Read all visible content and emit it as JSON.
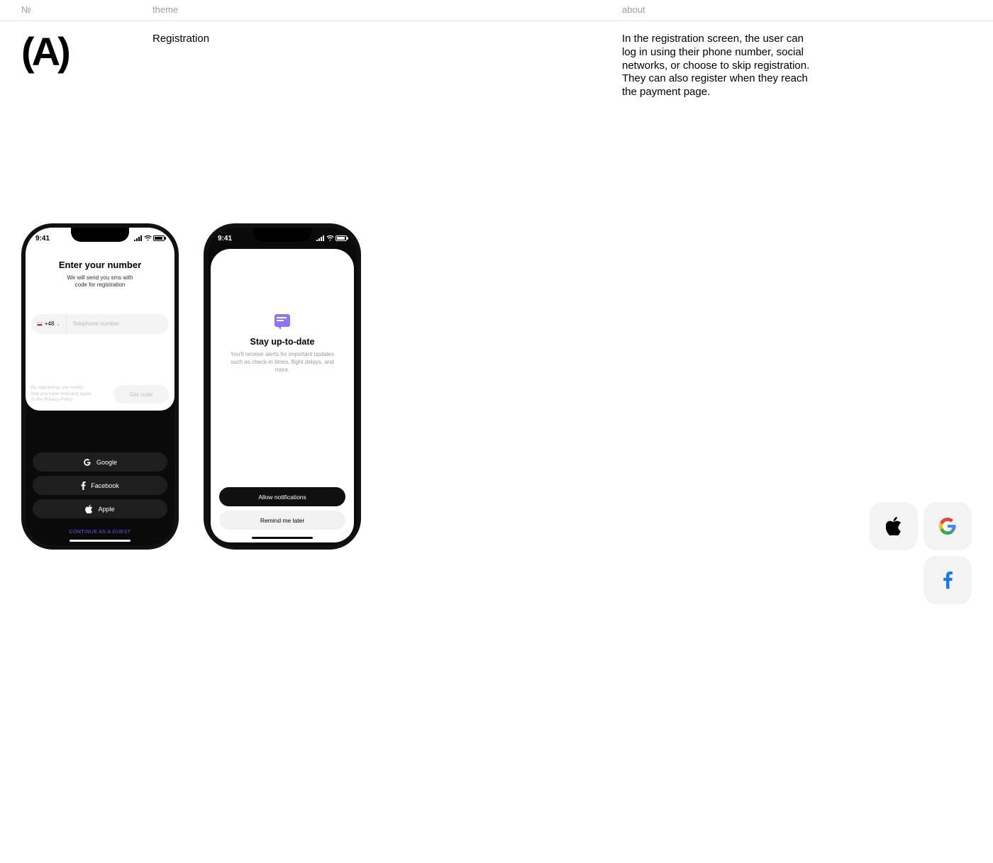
{
  "header": {
    "number_label": "№",
    "theme_label": "theme",
    "about_label": "about"
  },
  "page": {
    "marker": "(A)",
    "theme": "Registration",
    "about": "In the registration screen, the user can log in using their phone number, social networks, or choose to skip registration. They can also register when they reach the payment page."
  },
  "phone1": {
    "time": "9:41",
    "title": "Enter your number",
    "subtitle_l1": "We will send you sms with",
    "subtitle_l2": "code for registration",
    "country_code": "+48",
    "phone_placeholder": "Telephone number",
    "legal_l1": "By registering, you certify",
    "legal_l2": "that you have read and agree",
    "legal_l3": "to the Privacy Policy",
    "get_code": "Get code",
    "social": {
      "google": "Google",
      "facebook": "Facebook",
      "apple": "Apple"
    },
    "guest": "CONTINUE AS A GUEST"
  },
  "phone2": {
    "time": "9:41",
    "title": "Stay up-to-date",
    "subtitle": "You'll receive alerts for important updates such as check-in times, flight delays, and more.",
    "allow": "Allow notifications",
    "remind": "Remind me later"
  },
  "chips": {
    "apple": "apple",
    "google": "google",
    "facebook": "facebook"
  }
}
